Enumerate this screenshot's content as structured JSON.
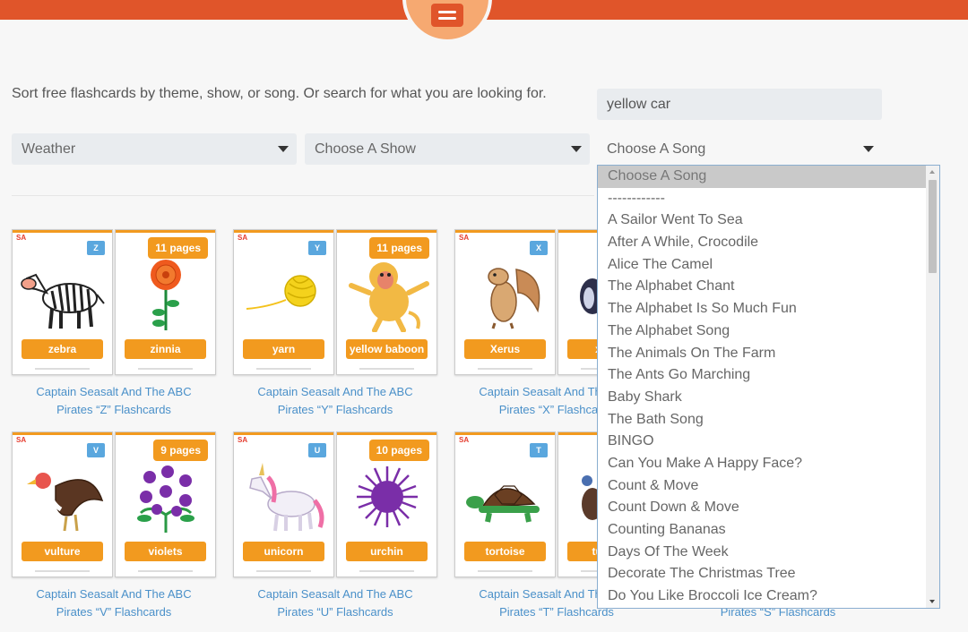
{
  "header": {
    "logo_icon": "sign-board-icon"
  },
  "intro": "Sort free flashcards by theme, show, or song. Or search for what you are looking for.",
  "search": {
    "value": "yellow car"
  },
  "filters": {
    "theme": "Weather",
    "show": "Choose A Show",
    "song": "Choose A Song"
  },
  "song_options": [
    "Choose A Song",
    "------------",
    "A Sailor Went To Sea",
    "After A While, Crocodile",
    "Alice The Camel",
    "The Alphabet Chant",
    "The Alphabet Is So Much Fun",
    "The Alphabet Song",
    "The Animals On The Farm",
    "The Ants Go Marching",
    "Baby Shark",
    "The Bath Song",
    "BINGO",
    "Can You Make A Happy Face?",
    "Count & Move",
    "Count Down & Move",
    "Counting Bananas",
    "Days Of The Week",
    "Decorate The Christmas Tree",
    "Do You Like Broccoli Ice Cream?"
  ],
  "cards": [
    {
      "letter": "Z",
      "left_word": "zebra",
      "right_word": "zinnia",
      "pages": "11 pages",
      "caption1": "Captain Seasalt And The ABC",
      "caption2": "Pirates “Z” Flashcards"
    },
    {
      "letter": "Y",
      "left_word": "yarn",
      "right_word": "yellow baboon",
      "pages": "11 pages",
      "caption1": "Captain Seasalt And The ABC",
      "caption2": "Pirates “Y” Flashcards"
    },
    {
      "letter": "X",
      "left_word": "Xerus",
      "right_word": "x-ray",
      "pages": "",
      "caption1": "Captain Seasalt And The ABC",
      "caption2": "Pirates “X” Flashcards"
    },
    {
      "letter": "V",
      "left_word": "vulture",
      "right_word": "violets",
      "pages": "9 pages",
      "caption1": "Captain Seasalt And The ABC",
      "caption2": "Pirates “V” Flashcards"
    },
    {
      "letter": "U",
      "left_word": "unicorn",
      "right_word": "urchin",
      "pages": "10 pages",
      "caption1": "Captain Seasalt And The ABC",
      "caption2": "Pirates “U” Flashcards"
    },
    {
      "letter": "T",
      "left_word": "tortoise",
      "right_word": "turkey",
      "pages": "",
      "caption1": "Captain Seasalt And The ABC",
      "caption2": "Pirates “T” Flashcards"
    },
    {
      "caption2": "Pirates “S” Flashcards"
    }
  ],
  "brand_mark": "SA"
}
